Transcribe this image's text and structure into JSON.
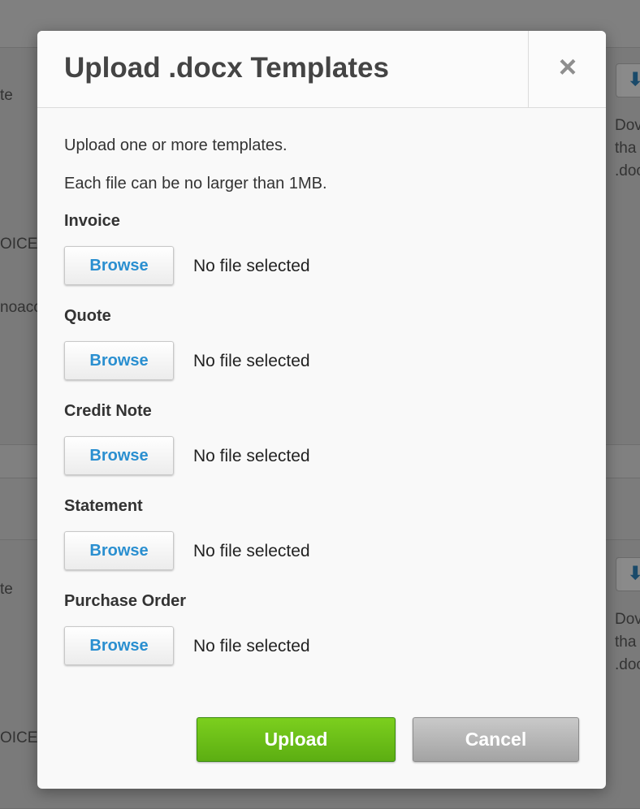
{
  "background": {
    "left_fragments": [
      "te",
      "OICE,",
      "noacc",
      "te",
      "OICE,"
    ],
    "right_fragments": [
      "Dov",
      "tha",
      ".doc",
      "Dov",
      "tha",
      ".doc"
    ]
  },
  "modal": {
    "title": "Upload .docx Templates",
    "close_symbol": "×",
    "intro_line1": "Upload one or more templates.",
    "intro_line2": "Each file can be no larger than 1MB.",
    "templates": [
      {
        "label": "Invoice",
        "browse_label": "Browse",
        "status": "No file selected"
      },
      {
        "label": "Quote",
        "browse_label": "Browse",
        "status": "No file selected"
      },
      {
        "label": "Credit Note",
        "browse_label": "Browse",
        "status": "No file selected"
      },
      {
        "label": "Statement",
        "browse_label": "Browse",
        "status": "No file selected"
      },
      {
        "label": "Purchase Order",
        "browse_label": "Browse",
        "status": "No file selected"
      }
    ],
    "upload_label": "Upload",
    "cancel_label": "Cancel"
  },
  "colors": {
    "upload_green": "#6cc218",
    "browse_blue": "#2a8fd0",
    "cancel_gray": "#b4b4b4"
  },
  "icons": {
    "close": "close-icon",
    "download": "download-icon"
  }
}
